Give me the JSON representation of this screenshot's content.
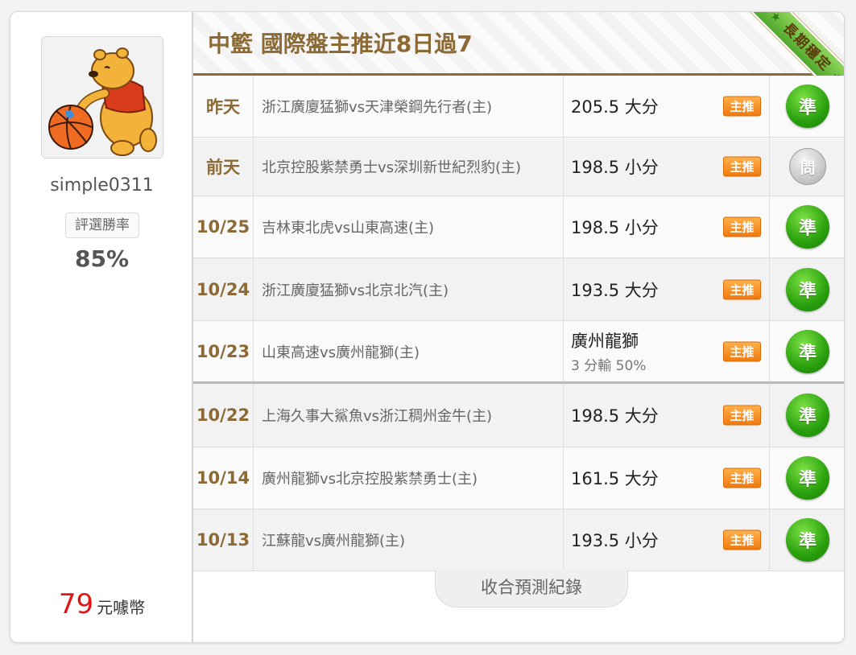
{
  "user": {
    "name": "simple0311",
    "rate_label": "評選勝率",
    "rate_value": "85%",
    "coins_value": "79",
    "coins_unit": "元噱幣"
  },
  "header": {
    "title": "中籃 國際盤主推近8日過7",
    "ribbon": "長期穩定"
  },
  "rows": [
    {
      "date": "昨天",
      "match": "浙江廣廈猛獅vs天津榮鋼先行者(主)",
      "pick": "205.5 大分",
      "pick_sub": "",
      "badge": "主推",
      "result": "準"
    },
    {
      "date": "前天",
      "match": "北京控股紫禁勇士vs深圳新世紀烈豹(主)",
      "pick": "198.5 小分",
      "pick_sub": "",
      "badge": "主推",
      "result": "問"
    },
    {
      "date": "10/25",
      "match": "吉林東北虎vs山東高速(主)",
      "pick": "198.5 小分",
      "pick_sub": "",
      "badge": "主推",
      "result": "準"
    },
    {
      "date": "10/24",
      "match": "浙江廣廈猛獅vs北京北汽(主)",
      "pick": "193.5 大分",
      "pick_sub": "",
      "badge": "主推",
      "result": "準"
    },
    {
      "date": "10/23",
      "match": "山東高速vs廣州龍獅(主)",
      "pick": "廣州龍獅",
      "pick_sub": "3 分輸 50%",
      "badge": "主推",
      "result": "準"
    },
    {
      "date": "10/22",
      "match": "上海久事大鯊魚vs浙江稠州金牛(主)",
      "pick": "198.5 大分",
      "pick_sub": "",
      "badge": "主推",
      "result": "準"
    },
    {
      "date": "10/14",
      "match": "廣州龍獅vs北京控股紫禁勇士(主)",
      "pick": "161.5 大分",
      "pick_sub": "",
      "badge": "主推",
      "result": "準"
    },
    {
      "date": "10/13",
      "match": "江蘇龍vs廣州龍獅(主)",
      "pick": "193.5 小分",
      "pick_sub": "",
      "badge": "主推",
      "result": "準"
    }
  ],
  "collapse_label": "收合預測紀錄"
}
